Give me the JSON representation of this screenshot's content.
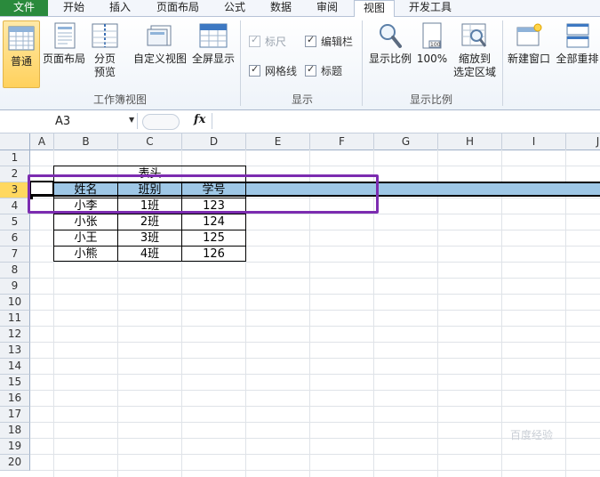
{
  "tabs": [
    "文件",
    "开始",
    "插入",
    "页面布局",
    "公式",
    "数据",
    "审阅",
    "视图",
    "开发工具"
  ],
  "active_tab": "视图",
  "ribbon": {
    "group_workbook_views": {
      "label": "工作簿视图",
      "normal": "普通",
      "page_layout": "页面布局",
      "page_break_preview_1": "分页",
      "page_break_preview_2": "预览",
      "custom_views": "自定义视图",
      "full_screen": "全屏显示"
    },
    "group_show": {
      "label": "显示",
      "ruler": "标尺",
      "formula_bar": "编辑栏",
      "gridlines": "网格线",
      "headings": "标题"
    },
    "group_zoom": {
      "label": "显示比例",
      "zoom": "显示比例",
      "zoom_100": "100%",
      "zoom_selection_1": "缩放到",
      "zoom_selection_2": "选定区域"
    },
    "group_window": {
      "new_window": "新建窗口",
      "arrange_all": "全部重排"
    }
  },
  "formula_bar": {
    "name_box": "A3",
    "fx": "fx",
    "content": ""
  },
  "columns": [
    "A",
    "B",
    "C",
    "D",
    "E",
    "F",
    "G",
    "H",
    "I",
    "J"
  ],
  "rows": [
    "1",
    "2",
    "3",
    "4",
    "5",
    "6",
    "7",
    "8",
    "9",
    "10",
    "11",
    "12",
    "13",
    "14",
    "15",
    "16",
    "17",
    "18",
    "19",
    "20"
  ],
  "table": {
    "title": "表头",
    "headers": [
      "姓名",
      "班别",
      "学号"
    ],
    "rows": [
      [
        "小李",
        "1班",
        "123"
      ],
      [
        "小张",
        "2班",
        "124"
      ],
      [
        "小王",
        "3班",
        "125"
      ],
      [
        "小熊",
        "4班",
        "126"
      ]
    ]
  },
  "watermark": "百度经验",
  "colors": {
    "file_tab": "#2a8a3c",
    "selected_row": "#9ec7e6",
    "highlight_box": "#7c2cb0",
    "header_selected": "#ffd860"
  }
}
